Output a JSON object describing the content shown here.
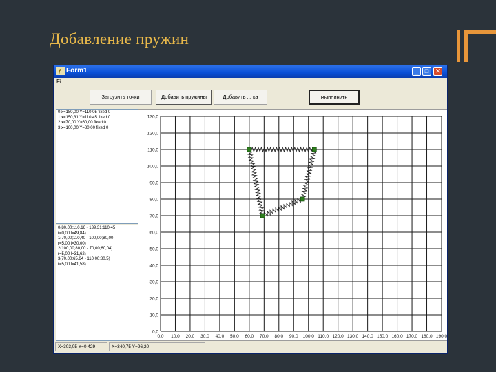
{
  "slide": {
    "title": "Добавление пружин"
  },
  "window": {
    "title": "Form1",
    "controls": {
      "minimize": "_",
      "maximize": "□",
      "close": "✕"
    },
    "menu": [
      "Fi"
    ]
  },
  "toolbar": {
    "buttons": [
      "Загрузить точки",
      "Добавить пружины",
      "Добавить ... ка",
      "Выполнить"
    ]
  },
  "memo_top": {
    "lines": [
      "0:x=180,00 Y=110,05 fixed 0",
      "1:x=150,31 Y=110,45 fixed 0",
      "2:x=70,00 Y=60,00 fixed 0",
      "3:x=100,00 Y=80,00 fixed 0"
    ]
  },
  "memo_bottom": {
    "lines": [
      "0(80,00;110,16 - 139,31;110,45",
      "r=0,00 l=49,84)",
      "1(70,00;110,40 - 100,00;80,00",
      "r=5,00 l=30,00)",
      "2(100,00;80,00 - 70,00;60,04)",
      "r=5,00 l=31,62)",
      "3(70,00;65,64 - 110,00;80,5)",
      "r=5,00 l=41,58)"
    ]
  },
  "status": {
    "left": "X=303,05 Y=0,429",
    "right": "X=340,75 Y=96,20"
  },
  "chart_data": {
    "type": "scatter",
    "title": "",
    "xlabel": "",
    "ylabel": "",
    "xlim": [
      0,
      190
    ],
    "ylim": [
      0,
      130
    ],
    "x_ticks": [
      "0,0",
      "10,0",
      "20,0",
      "30,0",
      "40,0",
      "50,0",
      "60,0",
      "70,0",
      "80,0",
      "90,0",
      "100,0",
      "110,0",
      "120,0",
      "130,0",
      "140,0",
      "150,0",
      "160,0",
      "170,0",
      "180,0",
      "190,0"
    ],
    "y_ticks": [
      "0,0",
      "10,0",
      "20,0",
      "30,0",
      "40,0",
      "50,0",
      "60,0",
      "70,0",
      "80,0",
      "90,0",
      "100,0",
      "110,0",
      "120,0",
      "130,0"
    ],
    "grid": true,
    "points": [
      {
        "x": 60,
        "y": 110
      },
      {
        "x": 104,
        "y": 110
      },
      {
        "x": 69,
        "y": 70
      },
      {
        "x": 96,
        "y": 80
      }
    ],
    "springs": [
      {
        "from": 0,
        "to": 1
      },
      {
        "from": 0,
        "to": 2
      },
      {
        "from": 1,
        "to": 3
      },
      {
        "from": 2,
        "to": 3
      }
    ],
    "colors": {
      "point": "#2e7d1e",
      "spring": "#222222",
      "grid": "#1a1a1a"
    }
  }
}
